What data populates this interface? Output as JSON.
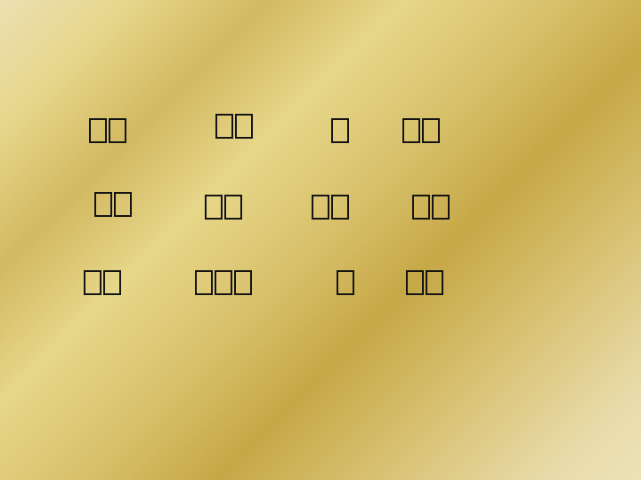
{
  "slide": {
    "words": [
      {
        "id": "r1-w1",
        "glyphs": 2
      },
      {
        "id": "r1-w2",
        "glyphs": 2
      },
      {
        "id": "r1-w3",
        "glyphs": 1
      },
      {
        "id": "r1-w4",
        "glyphs": 2
      },
      {
        "id": "r2-w1",
        "glyphs": 2
      },
      {
        "id": "r2-w2",
        "glyphs": 2
      },
      {
        "id": "r2-w3",
        "glyphs": 2
      },
      {
        "id": "r2-w4",
        "glyphs": 2
      },
      {
        "id": "r3-w1",
        "glyphs": 2
      },
      {
        "id": "r3-w2",
        "glyphs": 3
      },
      {
        "id": "r3-w3",
        "glyphs": 1
      },
      {
        "id": "r3-w4",
        "glyphs": 2
      }
    ]
  }
}
